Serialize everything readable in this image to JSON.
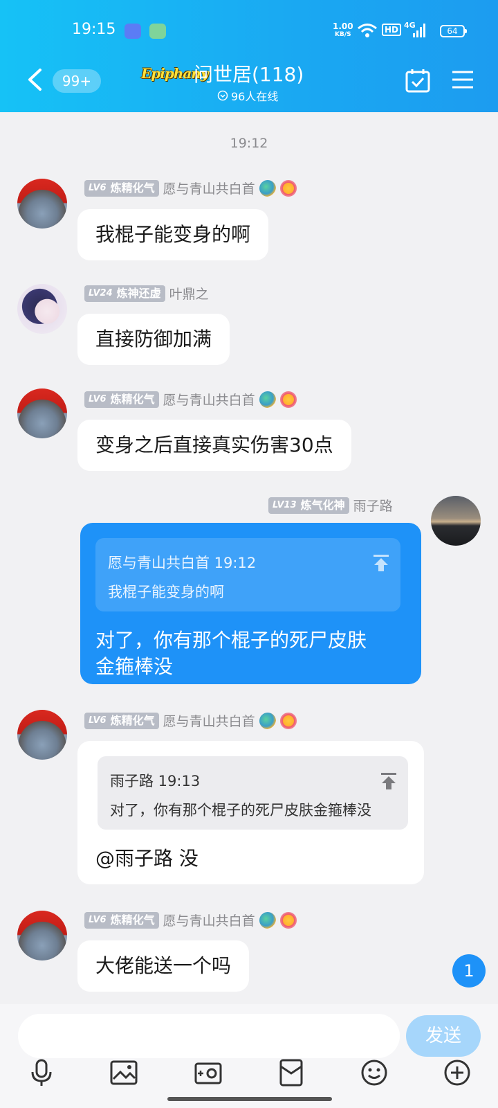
{
  "status_bar": {
    "time": "19:15",
    "net_speed_value": "1.00",
    "net_speed_unit": "KB/S",
    "hd": "HD",
    "network": "4G",
    "battery": "64"
  },
  "nav": {
    "unread_count": "99+",
    "logo_text": "Epiphany",
    "group_name": "问世居(118)",
    "online_text": "96人在线"
  },
  "chat": {
    "timestamp": "19:12",
    "messages": [
      {
        "level": "LV6",
        "rank": "炼精化气",
        "name": "愿与青山共白首",
        "text": "我棍子能变身的啊"
      },
      {
        "level": "LV24",
        "rank": "炼神还虚",
        "name": "叶鼎之",
        "text": "直接防御加满"
      },
      {
        "level": "LV6",
        "rank": "炼精化气",
        "name": "愿与青山共白首",
        "text": "变身之后直接真实伤害30点"
      },
      {
        "level": "LV13",
        "rank": "炼气化神",
        "name": "雨子路",
        "quote_author": "愿与青山共白首 19:12",
        "quote_text": "我棍子能变身的啊",
        "text_line1": "对了，你有那个棍子的死尸皮肤",
        "text_line2": "金箍棒没"
      },
      {
        "level": "LV6",
        "rank": "炼精化气",
        "name": "愿与青山共白首",
        "quote_author": "雨子路 19:13",
        "quote_text": "对了，你有那个棍子的死尸皮肤金箍棒没",
        "text": "@雨子路 没"
      },
      {
        "level": "LV6",
        "rank": "炼精化气",
        "name": "愿与青山共白首",
        "text": "大佬能送一个吗"
      }
    ],
    "unread_badge": "1"
  },
  "input": {
    "placeholder": "",
    "send_label": "发送"
  }
}
